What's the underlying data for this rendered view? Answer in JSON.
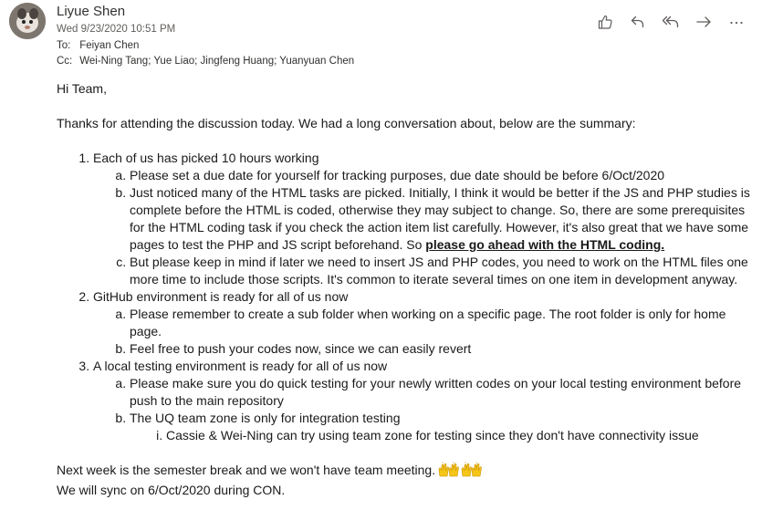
{
  "header": {
    "sender": "Liyue Shen",
    "date": "Wed 9/23/2020 10:51 PM",
    "to_label": "To:",
    "to": "Feiyan Chen",
    "cc_label": "Cc:",
    "cc": "Wei-Ning Tang; Yue Liao; Jingfeng Huang; Yuanyuan Chen",
    "icons": [
      "like-icon",
      "reply-icon",
      "reply-all-icon",
      "forward-icon",
      "more-icon"
    ]
  },
  "body": {
    "greeting": "Hi Team,",
    "intro": "Thanks for attending the discussion today. We had a long conversation about, below are the summary:",
    "item1": {
      "text": "Each of us has picked 10 hours working",
      "a": "Please set a due date for yourself for tracking purposes, due date should be before 6/Oct/2020",
      "b_text": "Just noticed many of the HTML tasks are picked. Initially, I think it would be better if the JS and PHP studies is complete before the HTML is coded, otherwise they may subject to change. So, there are some prerequisites for the HTML coding task if you check the action item list carefully. However, it's also great that we have some pages to test the PHP and JS script beforehand. So ",
      "b_emph": "please go ahead with the HTML coding.",
      "c": "But please keep in mind if later we need to insert JS and PHP codes, you need to work on the HTML files one more time to include those scripts. It's common to iterate several times on one item in development anyway."
    },
    "item2": {
      "text": "GitHub environment is ready for all of us now",
      "a": "Please remember to create a sub folder when working on a specific page. The root folder is only for home page.",
      "b": "Feel free to push your codes now, since we can easily revert"
    },
    "item3": {
      "text": "A local testing environment is ready for all of us now",
      "a": "Please make sure you do quick testing for your newly written codes on your local testing environment before push to the main repository",
      "b": "The UQ team zone is only for integration testing",
      "b_i": "Cassie & Wei-Ning can try using team zone for testing since they don't have connectivity issue"
    },
    "closing1": "Next week is the semester break and we won't have team meeting.",
    "closing1_emoji": "raising-hands-emoji",
    "closing2": "We will sync on 6/Oct/2020 during CON."
  },
  "colors": {
    "icon": "#605e5c",
    "emoji": "#f5c518"
  }
}
